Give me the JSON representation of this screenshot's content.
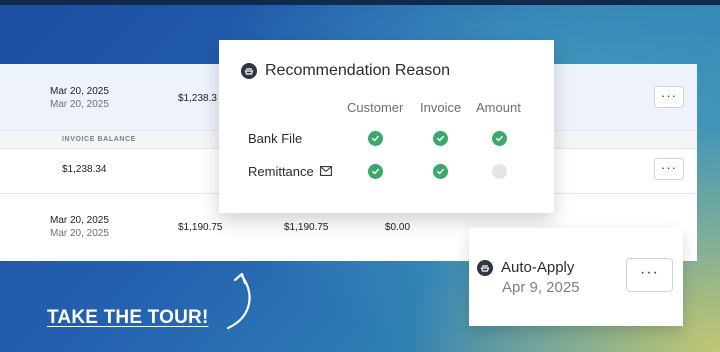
{
  "table": {
    "row_a": {
      "date": "Mar 20, 2025",
      "date_sub": "Mar 20, 2025",
      "amount": "$1,238.3"
    },
    "subheader": {
      "label": "INVOICE BALANCE"
    },
    "row_b": {
      "balance": "$1,238.34"
    },
    "row_c": {
      "date": "Mar 20, 2025",
      "date_sub": "Mar 20, 2025",
      "amount1": "$1,190.75",
      "amount2": "$1,190.75",
      "amount3": "$0.00"
    },
    "more_label": "···"
  },
  "popover": {
    "title": "Recommendation Reason",
    "columns": [
      "Customer",
      "Invoice",
      "Amount"
    ],
    "rows": [
      {
        "label": "Bank File",
        "checks": [
          true,
          true,
          true
        ]
      },
      {
        "label": "Remittance",
        "checks": [
          true,
          true,
          false
        ]
      }
    ]
  },
  "auto_apply": {
    "title": "Auto-Apply",
    "date": "Apr 9, 2025",
    "more_label": "···"
  },
  "tour": {
    "label": "TAKE THE TOUR!"
  },
  "colors": {
    "check": "#3da86b",
    "link": "#ffffff"
  }
}
